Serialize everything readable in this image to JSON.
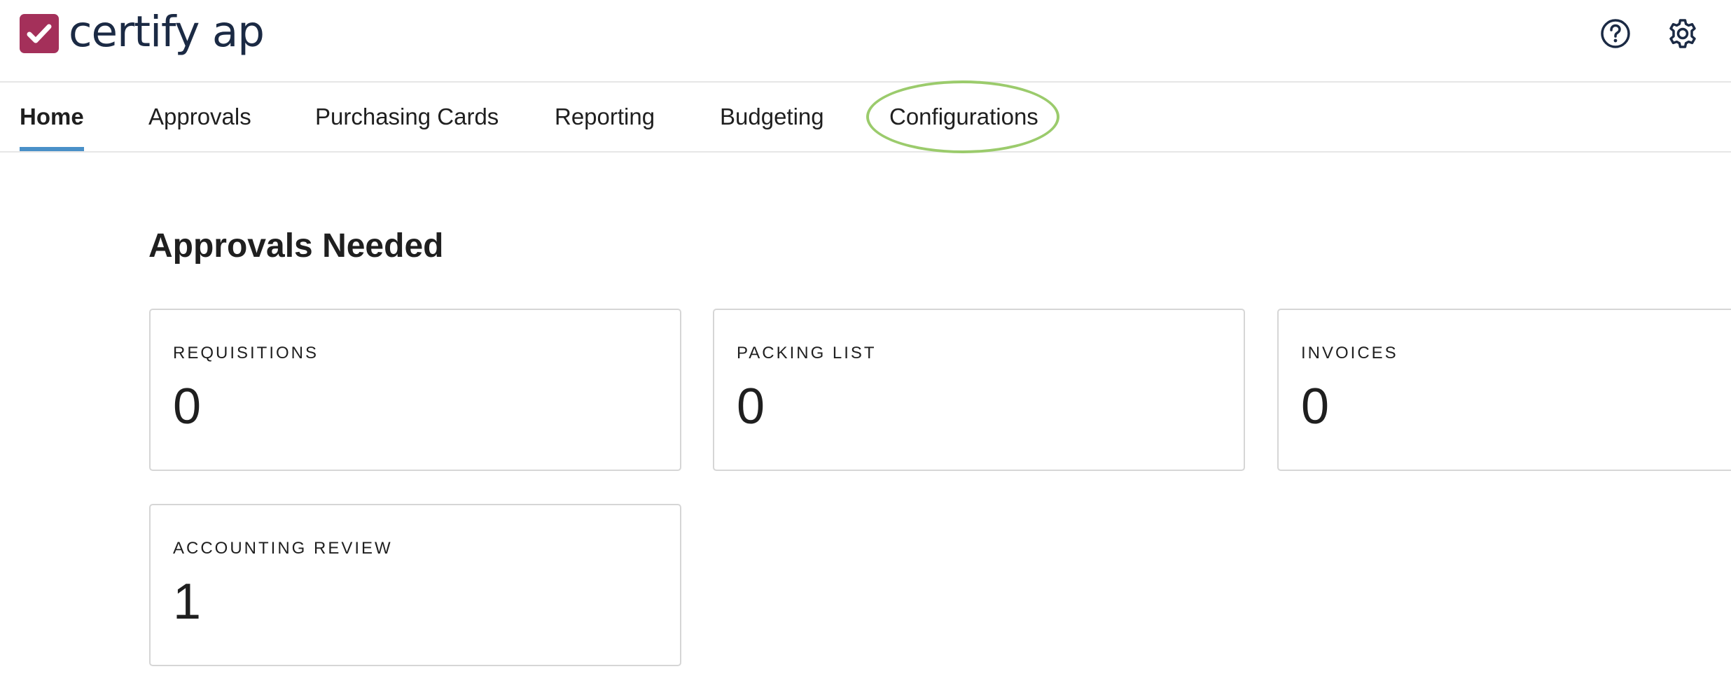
{
  "app": {
    "logo_text": "certify ap",
    "brand_color": "#a4305a",
    "text_color": "#1b2a44"
  },
  "header": {
    "icons": [
      "help-circle-icon",
      "gear-icon"
    ]
  },
  "tabs": [
    {
      "label": "Home",
      "active": true
    },
    {
      "label": "Approvals",
      "active": false
    },
    {
      "label": "Purchasing Cards",
      "active": false
    },
    {
      "label": "Reporting",
      "active": false
    },
    {
      "label": "Budgeting",
      "active": false
    },
    {
      "label": "Configurations",
      "active": false,
      "highlighted": true
    }
  ],
  "tab_indicator_color": "#4a90c8",
  "highlight_color": "#9bcb6c",
  "main": {
    "section_title": "Approvals Needed",
    "cards": [
      {
        "label": "REQUISITIONS",
        "value": "0"
      },
      {
        "label": "PACKING LIST",
        "value": "0"
      },
      {
        "label": "INVOICES",
        "value": "0"
      },
      {
        "label": "ACCOUNTING REVIEW",
        "value": "1"
      }
    ]
  }
}
